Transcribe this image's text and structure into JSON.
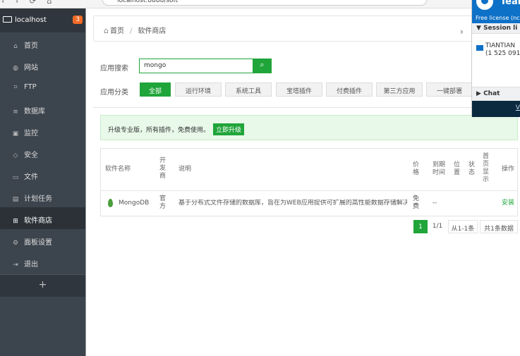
{
  "browser": {
    "nav_glyphs": "‹ › ⟳ ⌂",
    "url": "localhost:8888/soft"
  },
  "sidebar": {
    "host": "localhost",
    "badge": "3",
    "items": [
      {
        "icon": "⌂",
        "label": "首页"
      },
      {
        "icon": "◍",
        "label": "网站"
      },
      {
        "icon": "⌗",
        "label": "FTP"
      },
      {
        "icon": "≡",
        "label": "数据库"
      },
      {
        "icon": "▣",
        "label": "监控"
      },
      {
        "icon": "◇",
        "label": "安全"
      },
      {
        "icon": "▭",
        "label": "文件"
      },
      {
        "icon": "▤",
        "label": "计划任务"
      },
      {
        "icon": "⊞",
        "label": "软件商店"
      },
      {
        "icon": "⚙",
        "label": "面板设置"
      },
      {
        "icon": "⇥",
        "label": "退出"
      }
    ],
    "plus": "+"
  },
  "breadcrumb": {
    "home": "首页",
    "sep": "/",
    "current": "软件商店",
    "arrow": "›"
  },
  "search": {
    "label": "应用搜索",
    "value": "mongo",
    "button": "⌕"
  },
  "categories": {
    "label": "应用分类",
    "tags": [
      "全部",
      "运行环境",
      "系统工具",
      "宝塔插件",
      "付费插件",
      "第三方应用",
      "一键部署"
    ]
  },
  "notice": {
    "text": "升级专业版，所有插件，免费使用。",
    "button": "立即升级"
  },
  "table": {
    "headers": {
      "name": "软件名称",
      "dev": [
        "开",
        "发",
        "商"
      ],
      "desc": "说明",
      "price": [
        "价",
        "格"
      ],
      "expire": [
        "到期",
        "时间"
      ],
      "pos": [
        "位",
        "置"
      ],
      "status": [
        "状",
        "态"
      ],
      "show": [
        "首",
        "页",
        "显",
        "示"
      ],
      "op": "操作"
    },
    "rows": [
      {
        "name": "MongoDB",
        "dev": [
          "官",
          "方"
        ],
        "desc": "基于分布式文件存储的数据库，旨在为WEB应用提供可扩展的高性能数据存储解决方案!",
        "price": [
          "免",
          "费"
        ],
        "expire": "--",
        "op": "安装"
      }
    ]
  },
  "pagination": {
    "current": "1",
    "pages": "1/1",
    "range": "从1-1条",
    "total": "共1条数据"
  },
  "teamviewer": {
    "title": "Tean",
    "license": "Free license (nc",
    "session_header": "Session li",
    "session_name": "TIANTIAN",
    "session_id": "(1 525 091",
    "chat": "Chat",
    "link": "V",
    "colors": {
      "blue": "#0e71c8",
      "dark": "#0b2a3f"
    }
  },
  "colors": {
    "accent": "#20a53a",
    "sidebar": "#3c444d",
    "badge": "#f46a24"
  }
}
